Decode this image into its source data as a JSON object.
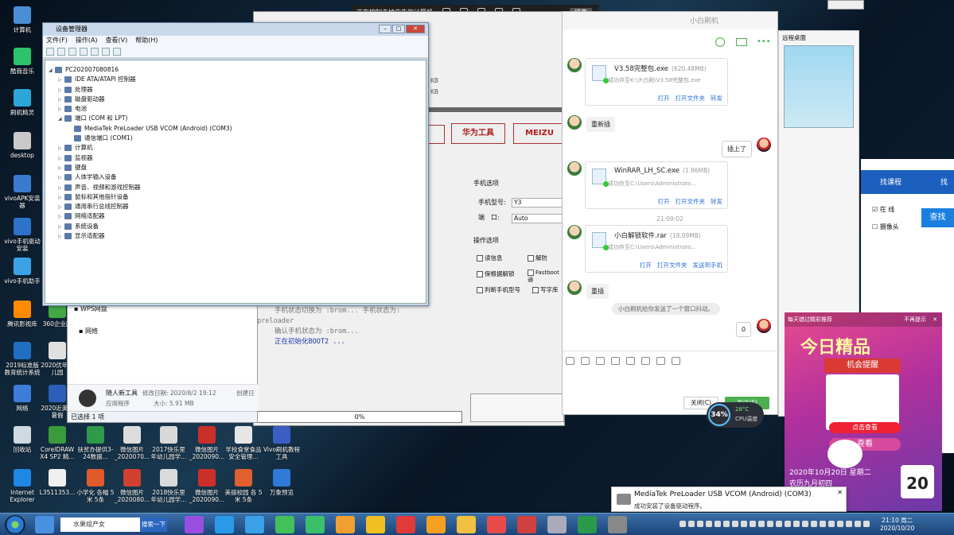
{
  "remote_bar": {
    "title": "正在控制去掉广告的计算机",
    "end": "结束"
  },
  "desktop_icons": [
    {
      "label": "计算机",
      "color": "#4a8fd6"
    },
    {
      "label": "酷我音乐",
      "color": "#2ec36b"
    },
    {
      "label": "刷机精灵",
      "color": "#2aa7d8"
    },
    {
      "label": "desktop",
      "color": "#c9c9c9"
    },
    {
      "label": "vivoAPK安装器",
      "color": "#3a7ad0"
    },
    {
      "label": "vivo手机驱动安装",
      "color": "#2d73c9"
    },
    {
      "label": "vivo手机助手",
      "color": "#3aa3e6"
    },
    {
      "label": "腾讯影视库",
      "color": "#ff8a00"
    },
    {
      "label": "360企业版",
      "color": "#41a844"
    },
    {
      "label": "2019标准版教育统计系统",
      "color": "#1f6fc2"
    },
    {
      "label": "2020优年幼儿园",
      "color": "#e0e0e0"
    },
    {
      "label": "网络",
      "color": "#3b7dd8"
    },
    {
      "label": "2020近英语暑假",
      "color": "#2b5fb8"
    },
    {
      "label": "回收站",
      "color": "#d0d8e0"
    },
    {
      "label": "CorelDRAW X4 SP2 精...",
      "color": "#3a9b3a"
    },
    {
      "label": "扶贫办提供3-24数据...",
      "color": "#2e9a4a"
    },
    {
      "label": "微信图片_2020070...",
      "color": "#dcdcdc"
    },
    {
      "label": "2017快乐里年幼儿园学...",
      "color": "#d8d8d8"
    },
    {
      "label": "微信图片_2020090...",
      "color": "#c8302a"
    },
    {
      "label": "学校食堂食品安全管理...",
      "color": "#e6e6e6"
    },
    {
      "label": "Vivo刷机教程工具",
      "color": "#3a5fc2"
    },
    {
      "label": "Internet Explorer",
      "color": "#1e88e5"
    },
    {
      "label": "L3511353...",
      "color": "#f0f0f0"
    },
    {
      "label": "小学化 各幅 5米 5条",
      "color": "#e05a2a"
    },
    {
      "label": "微信图片_2020080...",
      "color": "#d04030"
    },
    {
      "label": "2018快乐里年幼儿园学...",
      "color": "#dadada"
    },
    {
      "label": "微信图片_2020090...",
      "color": "#cc2f2a"
    },
    {
      "label": "美丽校园 各 5米 5条",
      "color": "#e06030"
    },
    {
      "label": "万象预览",
      "color": "#2f7ad6"
    }
  ],
  "device_manager": {
    "title": "设备管理器",
    "menu": [
      "文件(F)",
      "操作(A)",
      "查看(V)",
      "帮助(H)"
    ],
    "root": "PC202007080816",
    "items": [
      {
        "label": "IDE ATA/ATAPI 控制器",
        "level": 1,
        "exp": "▷"
      },
      {
        "label": "处理器",
        "level": 1,
        "exp": "▷"
      },
      {
        "label": "磁盘驱动器",
        "level": 1,
        "exp": "▷"
      },
      {
        "label": "电池",
        "level": 1,
        "exp": "▷"
      },
      {
        "label": "端口 (COM 和 LPT)",
        "level": 1,
        "exp": "◢"
      },
      {
        "label": "MediaTek PreLoader USB VCOM (Android) (COM3)",
        "level": 2,
        "exp": ""
      },
      {
        "label": "通信端口 (COM1)",
        "level": 2,
        "exp": ""
      },
      {
        "label": "计算机",
        "level": 1,
        "exp": "▷"
      },
      {
        "label": "监视器",
        "level": 1,
        "exp": "▷"
      },
      {
        "label": "键盘",
        "level": 1,
        "exp": "▷"
      },
      {
        "label": "人体学输入设备",
        "level": 1,
        "exp": "▷"
      },
      {
        "label": "声音、视频和游戏控制器",
        "level": 1,
        "exp": "▷"
      },
      {
        "label": "鼠标和其他指针设备",
        "level": 1,
        "exp": "▷"
      },
      {
        "label": "通用串行总线控制器",
        "level": 1,
        "exp": "▷"
      },
      {
        "label": "网络适配器",
        "level": 1,
        "exp": "▷"
      },
      {
        "label": "系统设备",
        "level": 1,
        "exp": "▷"
      },
      {
        "label": "显示适配器",
        "level": 1,
        "exp": "▷"
      }
    ]
  },
  "flash_tool": {
    "kb1": "KB",
    "kb2": "KB",
    "tab_huawei": "华为工具",
    "tab_meizu": "MEIZU",
    "phone_options": "手机选项",
    "model_label": "手机型号:",
    "model_value": "Y3",
    "port_label": "端　口:",
    "port_value": "Auto",
    "ops_label": "操作选项",
    "ops": [
      "读信息",
      "解防",
      "保根据解锁",
      "Fastboot 通",
      "判断手机型号",
      "写字库"
    ],
    "log": [
      "手机状态切换为 :brom...   手机状态为:",
      "preloader",
      "确认手机状态为 :brom...",
      "正在初始化BOOT2 ..."
    ],
    "progress": "0%"
  },
  "explorer": {
    "item1": "WPS网盘",
    "item2": "网络",
    "file_name": "随人新工具",
    "file_type": "应用程序",
    "modified": "修改日期: 2020/8/2 19:12",
    "size": "大小: 5.91 MB",
    "created": "创建日",
    "status": "已选择 1 项"
  },
  "chat": {
    "name": "小白刷机",
    "messages": {
      "file1": {
        "name": "V3.58完整包.exe",
        "size": "(620.48MB)",
        "path": "成功存至K:\\大白刷\\V3.58完整包.exe",
        "actions": [
          "打开",
          "打开文件夹",
          "转发"
        ]
      },
      "text1": "重新插",
      "text2": "插上了",
      "file2": {
        "name": "WinRAR_LH_SC.exe",
        "size": "(1.86MB)",
        "path": "成功存至C:\\Users\\Administrato...",
        "actions": [
          "打开",
          "打开文件夹",
          "转发"
        ]
      },
      "time": "21:09:02",
      "file3": {
        "name": "小白解锁软件.rar",
        "size": "(18.09MB)",
        "path": "成功存至C:\\Users\\Administrato...",
        "actions": [
          "打开",
          "打开文件夹",
          "发送到手机"
        ]
      },
      "text3": "重插",
      "system": "小白刷机给你发送了一个窗口抖动。",
      "text4": "0"
    },
    "close_btn": "关闭(C)",
    "send_btn": "发送(S)"
  },
  "side_panel": {
    "title": "远程桌面"
  },
  "webpage": {
    "nav1": "找课程",
    "nav2": "找",
    "check1": "在 线",
    "check2": "摄像头",
    "search": "查找"
  },
  "ad": {
    "header": "每天错过精彩推荐",
    "no_remind": "不再提示",
    "title": "今日精品",
    "subtitle": "机会提醒",
    "cta": "点击查看",
    "cta2": "查看",
    "date": "2020年10月20日 星期二",
    "day": "20",
    "line2": "农历九月初四",
    "line3": "日"
  },
  "cpu": {
    "percent": "34%",
    "temp": "28°C",
    "label": "CPU温度"
  },
  "notification": {
    "title": "MediaTek PreLoader USB VCOM (Android) (COM3)",
    "body": "成功安装了设备驱动程序。"
  },
  "taskbar": {
    "search_value": "水果组产女",
    "search_btn": "搜索一下",
    "time": "21:10 周二",
    "date": "2020/10/20"
  }
}
